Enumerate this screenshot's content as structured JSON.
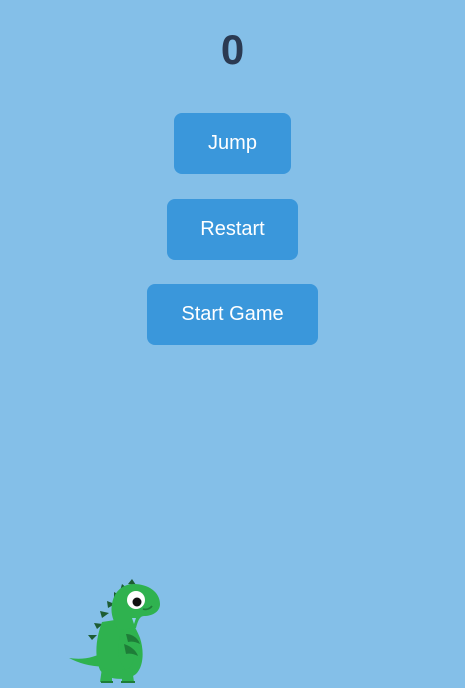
{
  "colors": {
    "background": "#84bfe8",
    "button": "#3a97db",
    "button_text": "#ffffff",
    "score_text": "#2b3a52",
    "dino_body": "#2fb24f",
    "dino_dark": "#1e7d38",
    "dino_spikes": "#1d5c33"
  },
  "game": {
    "score": "0"
  },
  "controls": {
    "jump_label": "Jump",
    "restart_label": "Restart",
    "start_label": "Start Game"
  },
  "player": {
    "character": "green-dinosaur",
    "icon": "dinosaur-icon"
  }
}
